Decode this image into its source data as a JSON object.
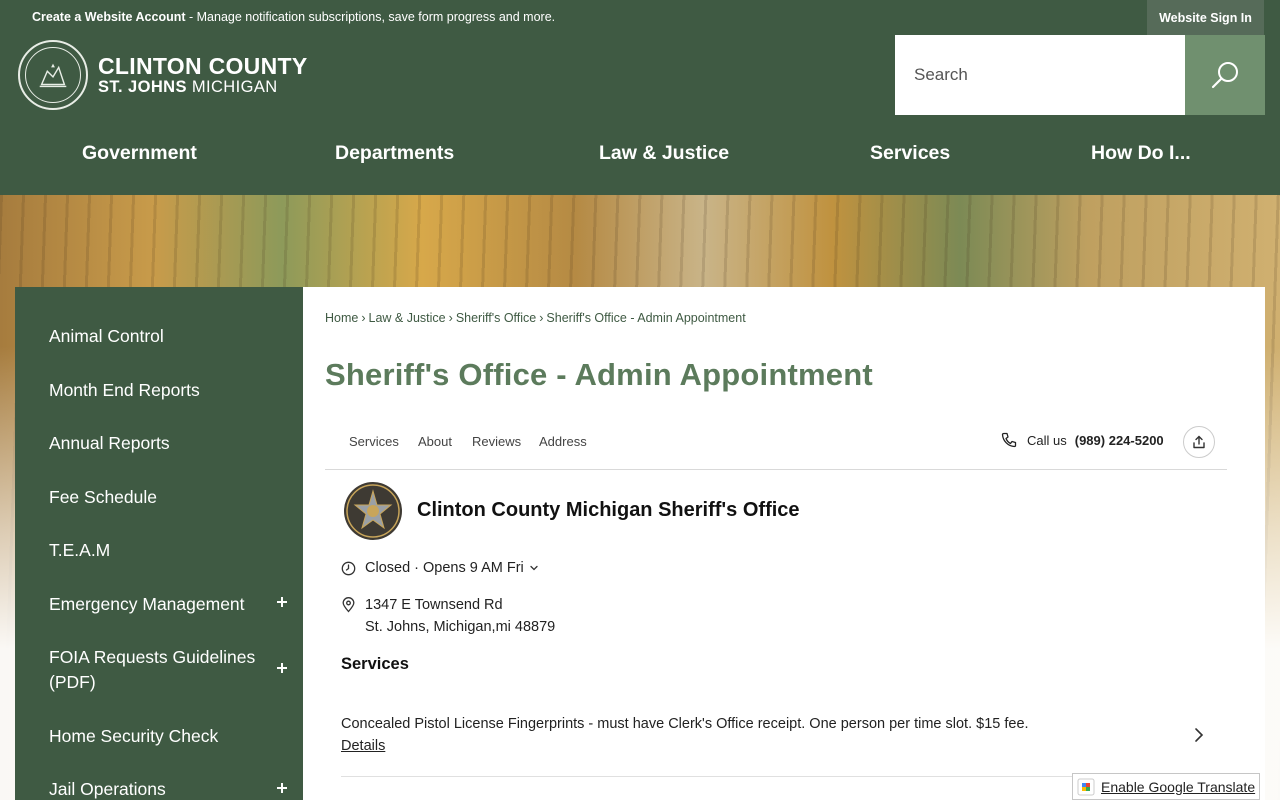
{
  "topbar": {
    "create_account": "Create a Website Account",
    "message": " - Manage notification subscriptions, save form progress and more.",
    "sign_in": "Website Sign In"
  },
  "logo": {
    "line1": "CLINTON COUNTY",
    "line2_bold": "ST. JOHNS",
    "line2_light": " MICHIGAN"
  },
  "search": {
    "placeholder": "Search"
  },
  "nav": [
    "Government",
    "Departments",
    "Law & Justice",
    "Services",
    "How Do I..."
  ],
  "sidebar": {
    "items": [
      {
        "label": "Animal Control"
      },
      {
        "label": "Month End Reports"
      },
      {
        "label": "Annual Reports"
      },
      {
        "label": "Fee Schedule"
      },
      {
        "label": "T.E.A.M"
      },
      {
        "label": "Emergency Management"
      },
      {
        "label": "FOIA Requests Guidelines (PDF)"
      },
      {
        "label": "Home Security Check"
      },
      {
        "label": "Jail Operations"
      }
    ]
  },
  "breadcrumb": [
    "Home",
    "Law & Justice",
    "Sheriff's Office",
    "Sheriff's Office - Admin Appointment"
  ],
  "page_title": "Sheriff's Office - Admin Appointment",
  "booking": {
    "tabs": [
      "Services",
      "About",
      "Reviews",
      "Address"
    ],
    "call_label": "Call us",
    "phone": "(989) 224-5200",
    "badge_text_top": "CLINTON",
    "badge_text_bottom": "COUNTY",
    "business_name": "Clinton County Michigan Sheriff's Office",
    "hours_status": "Closed · Opens 9 AM Fri",
    "address_line1": "1347 E Townsend Rd",
    "address_line2": "St. Johns, Michigan,mi 48879",
    "services_heading": "Services",
    "service": {
      "description": "Concealed Pistol License Fingerprints - must have Clerk's Office receipt. One person per time slot. $15 fee.",
      "details_link": "Details"
    }
  },
  "translate": {
    "label": "Enable Google Translate"
  },
  "colors": {
    "brand_green": "#3f5a43",
    "title_green": "#5c7b5c",
    "search_button": "#70906f"
  }
}
